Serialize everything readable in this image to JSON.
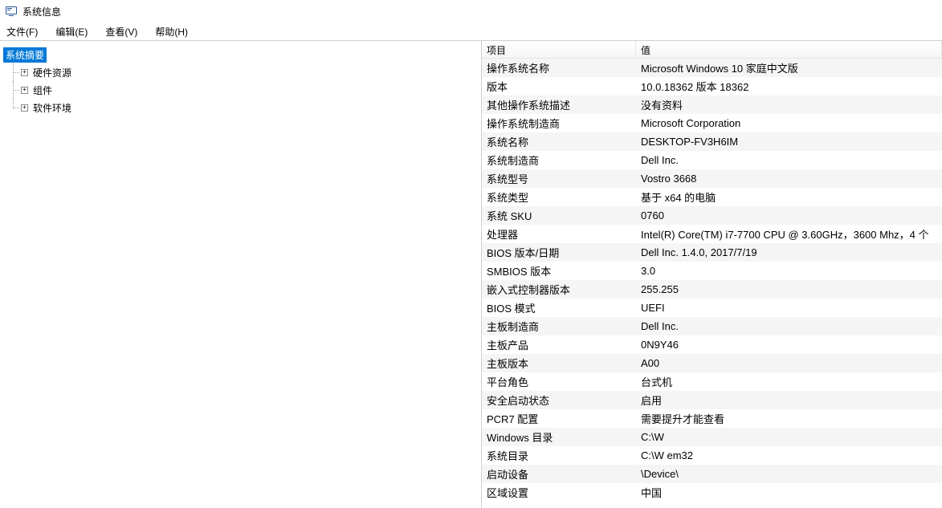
{
  "window": {
    "title": "系统信息"
  },
  "menu": {
    "file": "文件(F)",
    "edit": "编辑(E)",
    "view": "查看(V)",
    "help": "帮助(H)"
  },
  "tree": {
    "root": "系统摘要",
    "children": [
      "硬件资源",
      "组件",
      "软件环境"
    ]
  },
  "list": {
    "header_key": "项目",
    "header_value": "值",
    "rows": [
      {
        "k": "操作系统名称",
        "v": "Microsoft Windows 10 家庭中文版"
      },
      {
        "k": "版本",
        "v": "10.0.18362 版本 18362"
      },
      {
        "k": "其他操作系统描述",
        "v": "没有资料"
      },
      {
        "k": "操作系统制造商",
        "v": "Microsoft Corporation"
      },
      {
        "k": "系统名称",
        "v": "DESKTOP-FV3H6IM"
      },
      {
        "k": "系统制造商",
        "v": "Dell Inc."
      },
      {
        "k": "系统型号",
        "v": "Vostro 3668"
      },
      {
        "k": "系统类型",
        "v": "基于 x64 的电脑"
      },
      {
        "k": "系统 SKU",
        "v": "0760"
      },
      {
        "k": "处理器",
        "v": "Intel(R) Core(TM) i7-7700 CPU @ 3.60GHz，3600 Mhz，4 个"
      },
      {
        "k": "BIOS 版本/日期",
        "v": "Dell Inc. 1.4.0, 2017/7/19"
      },
      {
        "k": "SMBIOS 版本",
        "v": "3.0"
      },
      {
        "k": "嵌入式控制器版本",
        "v": "255.255"
      },
      {
        "k": "BIOS 模式",
        "v": "UEFI"
      },
      {
        "k": "主板制造商",
        "v": "Dell Inc."
      },
      {
        "k": "主板产品",
        "v": "0N9Y46"
      },
      {
        "k": "主板版本",
        "v": "A00"
      },
      {
        "k": "平台角色",
        "v": "台式机"
      },
      {
        "k": "安全启动状态",
        "v": "启用"
      },
      {
        "k": "PCR7 配置",
        "v": "需要提升才能查看"
      },
      {
        "k": "Windows 目录",
        "v": "C:\\W"
      },
      {
        "k": "系统目录",
        "v": "C:\\W               em32"
      },
      {
        "k": "启动设备",
        "v": "\\Device\\"
      },
      {
        "k": "区域设置",
        "v": "中国"
      }
    ]
  }
}
